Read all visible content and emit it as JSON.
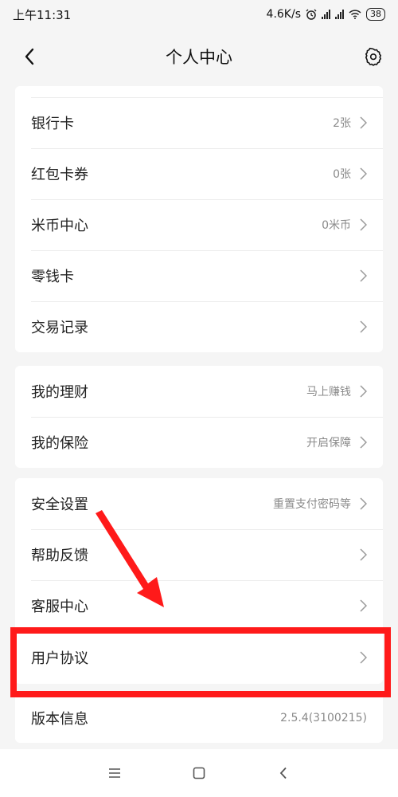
{
  "status": {
    "time": "上午11:31",
    "speed": "4.6K/s",
    "battery": "38"
  },
  "header": {
    "title": "个人中心"
  },
  "card1": {
    "rows": [
      {
        "label": "银行卡",
        "value": "2张"
      },
      {
        "label": "红包卡券",
        "value": "0张"
      },
      {
        "label": "米币中心",
        "value": "0米币"
      },
      {
        "label": "零钱卡",
        "value": ""
      },
      {
        "label": "交易记录",
        "value": ""
      }
    ]
  },
  "card2": {
    "rows": [
      {
        "label": "我的理财",
        "value": "马上赚钱"
      },
      {
        "label": "我的保险",
        "value": "开启保障"
      }
    ]
  },
  "card3": {
    "rows": [
      {
        "label": "安全设置",
        "value": "重置支付密码等"
      },
      {
        "label": "帮助反馈",
        "value": ""
      },
      {
        "label": "客服中心",
        "value": ""
      },
      {
        "label": "用户协议",
        "value": ""
      }
    ]
  },
  "card4": {
    "rows": [
      {
        "label": "版本信息",
        "value": "2.5.4(3100215)"
      }
    ]
  },
  "colors": {
    "highlight": "#ff1a1a",
    "arrow": "#ff1a1a"
  },
  "icons": {
    "back": "chevron-left-icon",
    "settings": "gear-icon",
    "row_arrow": "chevron-right-icon"
  }
}
